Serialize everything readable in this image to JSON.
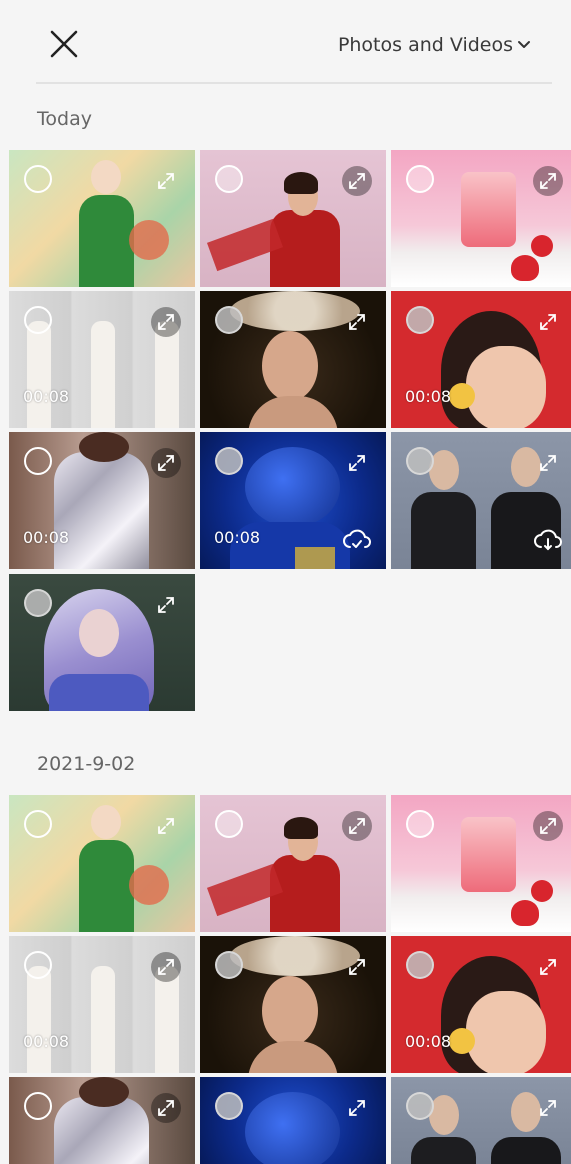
{
  "header": {
    "filter_label": "Photos and Videos",
    "filter_icon": "chevron-down-icon",
    "close_icon": "close-icon"
  },
  "sections": [
    {
      "title": "Today",
      "items": [
        {
          "type": "photo"
        },
        {
          "type": "photo"
        },
        {
          "type": "photo"
        },
        {
          "type": "video",
          "duration": "00:08"
        },
        {
          "type": "photo"
        },
        {
          "type": "video",
          "duration": "00:08"
        },
        {
          "type": "video",
          "duration": "00:08"
        },
        {
          "type": "video",
          "duration": "00:08",
          "cloud": "cloud-check-icon"
        },
        {
          "type": "photo",
          "cloud": "cloud-download-icon"
        },
        {
          "type": "photo"
        }
      ]
    },
    {
      "title": "2021-9-02",
      "items": [
        {
          "type": "photo"
        },
        {
          "type": "photo"
        },
        {
          "type": "photo"
        },
        {
          "type": "video",
          "duration": "00:08"
        },
        {
          "type": "photo"
        },
        {
          "type": "video",
          "duration": "00:08"
        },
        {
          "type": "photo"
        },
        {
          "type": "photo"
        },
        {
          "type": "photo"
        }
      ]
    }
  ],
  "colors": {
    "background": "#f5f5f5",
    "text_secondary": "#666666",
    "text_primary": "#3a3a3a",
    "divider": "#e2e2e2"
  }
}
